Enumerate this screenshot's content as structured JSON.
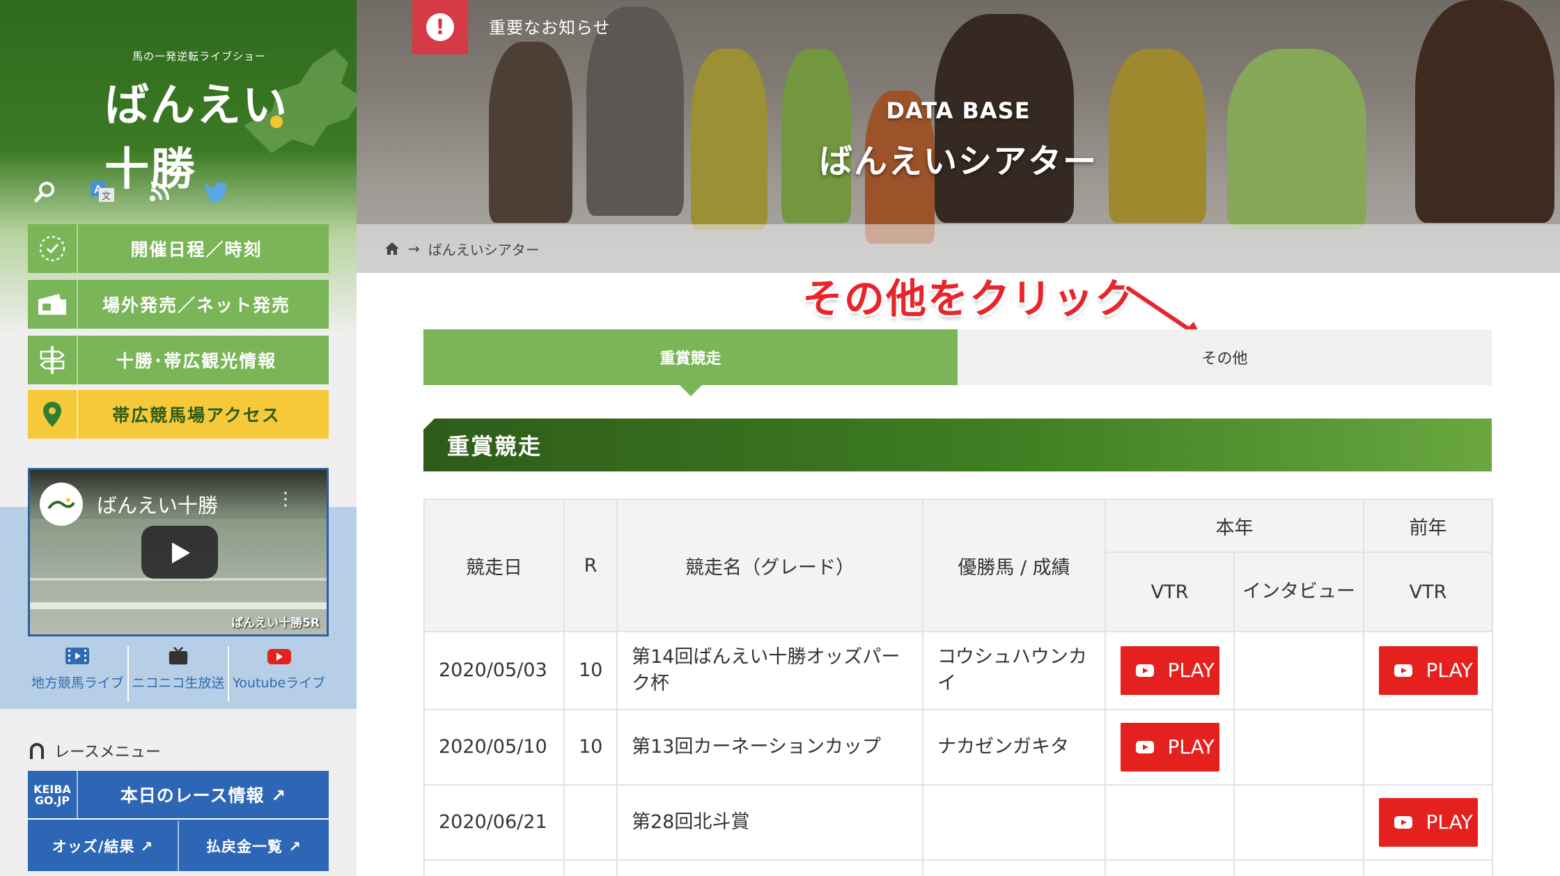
{
  "sidebar": {
    "logo_tagline": "馬の一発逆転ライブショー",
    "logo_text": "ばんえい十勝",
    "nav": [
      {
        "label": "開催日程／時刻",
        "icon": "clock-icon"
      },
      {
        "label": "場外発売／ネット発売",
        "icon": "ticket-icon"
      },
      {
        "label": "十勝･帯広観光情報",
        "icon": "signpost-icon"
      },
      {
        "label": "帯広競馬場アクセス",
        "icon": "map-pin-icon"
      }
    ],
    "video": {
      "title": "ばんえい十勝",
      "caption": "ばんえい十勝5R"
    },
    "live_links": [
      {
        "label": "地方競馬ライブ",
        "icon": "film-icon"
      },
      {
        "label": "ニコニコ生放送",
        "icon": "tv-icon"
      },
      {
        "label": "Youtubeライブ",
        "icon": "youtube-icon"
      }
    ],
    "race_menu_title": "レースメニュー",
    "keiba": {
      "logo": "KEIBA GO.JP",
      "today": "本日のレース情報 ↗",
      "odds": "オッズ/結果 ↗",
      "payout": "払戻金一覧 ↗"
    }
  },
  "hero": {
    "notice": "重要なお知らせ",
    "subtitle": "DATA BASE",
    "title": "ばんえいシアター",
    "breadcrumb_current": "ばんえいシアター"
  },
  "annotation": "その他をクリック",
  "tabs": [
    {
      "label": "重賞競走",
      "active": true
    },
    {
      "label": "その他",
      "active": false
    }
  ],
  "section_heading": "重賞競走",
  "table": {
    "headers": {
      "date": "競走日",
      "r": "R",
      "race_name": "競走名（グレード）",
      "winner": "優勝馬 / 成績",
      "this_year": "本年",
      "last_year": "前年",
      "vtr": "VTR",
      "interview": "インタビュー"
    },
    "play_label": "PLAY",
    "rows": [
      {
        "date": "2020/05/03",
        "r": "10",
        "race": "第14回ばんえい十勝オッズパーク杯",
        "winner": "コウシュハウンカイ",
        "vtr": true,
        "interview": false,
        "prev_vtr": true
      },
      {
        "date": "2020/05/10",
        "r": "10",
        "race": "第13回カーネーションカップ",
        "winner": "ナカゼンガキタ",
        "vtr": true,
        "interview": false,
        "prev_vtr": false
      },
      {
        "date": "2020/06/21",
        "r": "",
        "race": "第28回北斗賞",
        "winner": "",
        "vtr": false,
        "interview": false,
        "prev_vtr": true
      }
    ]
  },
  "colors": {
    "green_dark": "#2e5c19",
    "green_light": "#7ab557",
    "yellow": "#f5c93a",
    "red": "#e5211f",
    "blue": "#2d66b4"
  }
}
